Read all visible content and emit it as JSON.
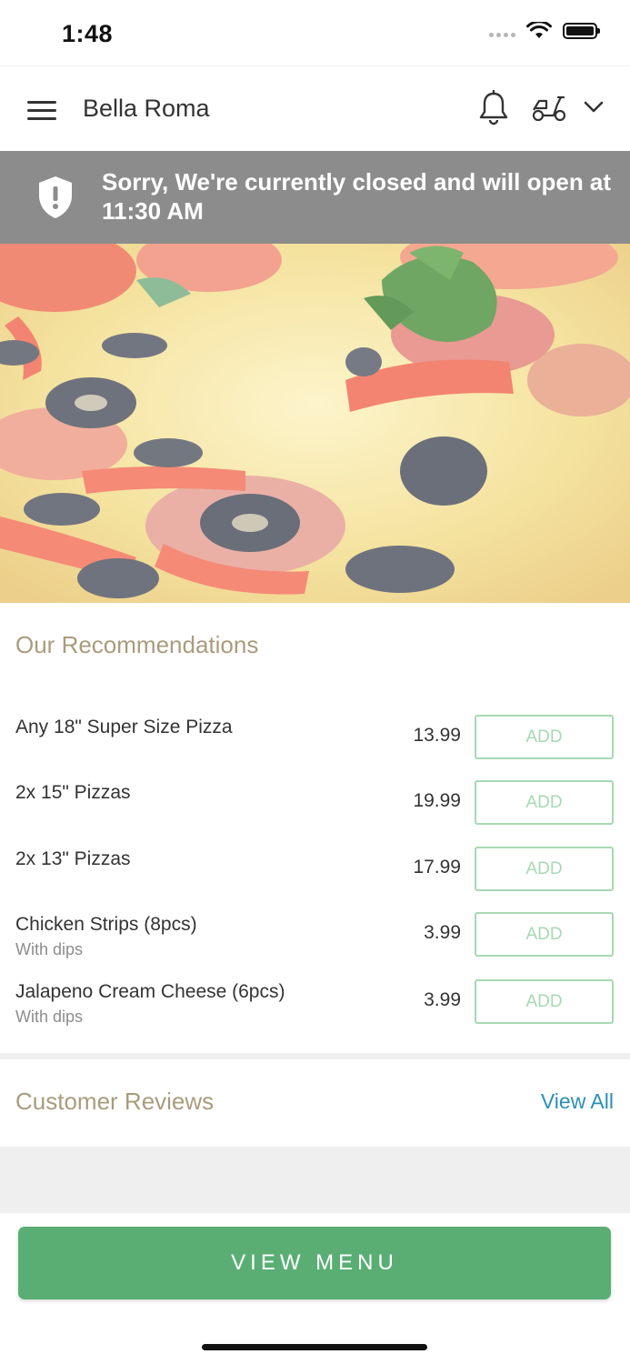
{
  "status_bar": {
    "time": "1:48"
  },
  "nav": {
    "title": "Bella Roma",
    "icons": [
      "menu-icon",
      "bell-icon",
      "scooter-icon",
      "chevron-down-icon"
    ]
  },
  "banner": {
    "message": "Sorry, We're currently closed and will open at 11:30 AM",
    "icon": "shield-alert-icon"
  },
  "recommendations": {
    "title": "Our Recommendations",
    "add_label": "ADD",
    "items": [
      {
        "name": "Any 18\" Super Size Pizza",
        "subtitle": "",
        "price": "13.99"
      },
      {
        "name": "2x 15\" Pizzas",
        "subtitle": "",
        "price": "19.99"
      },
      {
        "name": "2x 13\" Pizzas",
        "subtitle": "",
        "price": "17.99"
      },
      {
        "name": "Chicken Strips (8pcs)",
        "subtitle": "With dips",
        "price": "3.99"
      },
      {
        "name": "Jalapeno Cream Cheese (6pcs)",
        "subtitle": "With dips",
        "price": "3.99"
      }
    ]
  },
  "reviews": {
    "title": "Customer Reviews",
    "view_all": "View All"
  },
  "footer": {
    "button_label": "VIEW MENU"
  },
  "colors": {
    "accent_green": "#5aae74",
    "banner_gray": "#8c8c8c",
    "heading_tan": "#a99c7d",
    "link_blue": "#2b8fb7"
  }
}
